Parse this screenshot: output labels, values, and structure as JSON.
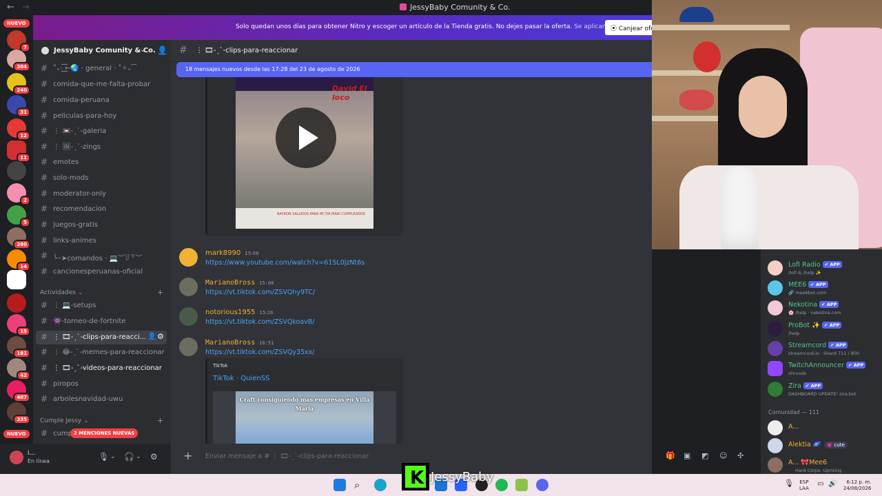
{
  "window": {
    "title": "JessyBaby Comunity & Co."
  },
  "rail": {
    "nuevo_top": "NUEVO",
    "nuevo_bottom": "NUEVO",
    "badges": [
      "7",
      "304",
      "240",
      "31",
      "12",
      "11",
      "2",
      "5",
      "280",
      "14",
      "15",
      "181",
      "42",
      "407",
      "335"
    ]
  },
  "nitro": {
    "text": "Solo quedan unos días para obtener Nitro y escoger un artículo de la Tienda gratis. No dejes pasar la oferta.",
    "link": "Se aplican condiciones.",
    "button": "Canjear ofe"
  },
  "server": {
    "name": "JessyBaby Comunity & Co."
  },
  "channels": [
    {
      "name": "˚₊· ͟͟͞͞➳🌏 · general · ˚✧₊⁀"
    },
    {
      "name": "comida-que-me-falta-probar"
    },
    {
      "name": "comida-peruana"
    },
    {
      "name": "peliculas-para-hoy"
    },
    {
      "name": "⋮ 📼-ˏˋ-galeria"
    },
    {
      "name": "⋮ 🖼-ˏˋ-zings"
    },
    {
      "name": "emotes"
    },
    {
      "name": "solo-mods"
    },
    {
      "name": "moderator-only"
    },
    {
      "name": "recomendacion"
    },
    {
      "name": "juegos-gratis"
    },
    {
      "name": "links-animes"
    },
    {
      "name": "╰┈➤comandos · 💻︶꒦꒷︶"
    },
    {
      "name": "cancionesperuanas-oficial"
    }
  ],
  "categories": {
    "actividades": "Actividades",
    "cumple": "Cumple Jessy"
  },
  "activity_channels": [
    {
      "name": "⋮ 💻-setups"
    },
    {
      "name": "👾-torneo-de-fortnite"
    },
    {
      "name": "⋮ 🎞-ˏˋ-clips-para-reacci..."
    },
    {
      "name": "⋮ 😂-ˏˋ-memes-para-reaccionar"
    },
    {
      "name": "⋮ 🎞-ˏˋ-videos-para-reaccionar"
    },
    {
      "name": "piropos"
    },
    {
      "name": "arbolesnavidad-uwu"
    }
  ],
  "cumple_channel": "cump",
  "mentions_pill": "2 MENCIONES NUEVAS",
  "user": {
    "name": "i...",
    "status": "En línea"
  },
  "chat": {
    "channel": "⋮ 🎞-ˏˋ-clips-para-reaccionar",
    "new_messages": "18 mensajes nuevos desde las 17:28 del 23 de agosto de 2026",
    "video_tag": "David El loco",
    "video_caption": "BAYRON SALUDOS PARA MI TIA MARI CUMPLEAÑOS",
    "messages": [
      {
        "user": "mark8990",
        "time": "15:08",
        "link": "https://www.youtube.com/watch?v=61SL0jzNt6s"
      },
      {
        "user": "MarianoBross",
        "time": "15:08",
        "link": "https://vt.tiktok.com/ZSVQhy9TC/"
      },
      {
        "user": "notorious1955",
        "time": "15:26",
        "link": "https://vt.tiktok.com/ZSVQkoavB/"
      },
      {
        "user": "MarianoBross",
        "time": "16:51",
        "link": "https://vt.tiktok.com/ZSVQy35xx/"
      }
    ],
    "embed": {
      "provider": "TikTok",
      "title": "TikTok · QuienSS",
      "thumb_text": "Craft consiguiendo mas empresas en Villa Maria"
    },
    "composer_placeholder": "Enviar mensaje a # ⋮ 🎞-ˏˋ-clips-para-reaccionar"
  },
  "members": [
    {
      "name": "Lofi Radio",
      "status": "/lofi & /help ✨",
      "app": "APP"
    },
    {
      "name": "MEE6",
      "status": "🔗 mee6bot.com",
      "app": "APP"
    },
    {
      "name": "Nekotina",
      "status": "🌸 /help · nekotina.com",
      "app": "APP"
    },
    {
      "name": "ProBot ✨",
      "status": "/help",
      "app": "APP"
    },
    {
      "name": "Streamcord",
      "status": "streamcord.io · Shard 711 / 800",
      "app": "APP"
    },
    {
      "name": "TwitchAnnouncer",
      "status": "ohrvods",
      "app": "APP"
    },
    {
      "name": "Zira",
      "status": "DASHBOARD UPDATE! zira.bot",
      "app": "APP"
    }
  ],
  "community_label": "Comunidad — 111",
  "community": [
    {
      "name": "A..."
    },
    {
      "name": "Alektia 🌌",
      "tag": "💗 cute"
    },
    {
      "name": "A... 🎀Mee6",
      "status": "Hard Corps: Uprising"
    }
  ],
  "overlay": {
    "name": "JessyBaby"
  },
  "taskbar": {
    "lang1": "ESP",
    "lang2": "LAA",
    "time": "6:12 p. m.",
    "date": "24/08/2026"
  }
}
